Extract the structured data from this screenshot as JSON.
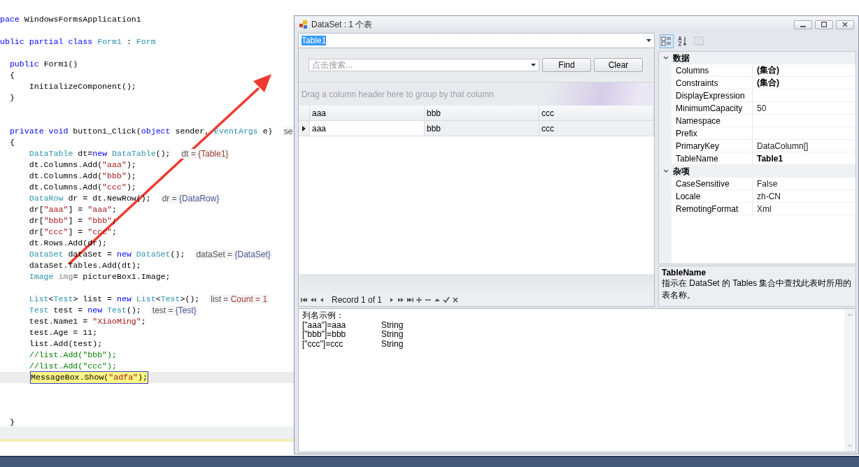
{
  "editor": {
    "lines": [
      {
        "kind": "code",
        "current": false,
        "segments": [
          {
            "kind": "keyword",
            "text": "pace"
          },
          {
            "kind": "plain",
            "text": " WindowsFormsApplication1"
          }
        ]
      },
      {
        "kind": "blank",
        "current": false
      },
      {
        "kind": "code",
        "current": false,
        "segments": [
          {
            "kind": "keyword",
            "text": "ublic partial class "
          },
          {
            "kind": "type",
            "text": "Form1"
          },
          {
            "kind": "plain",
            "text": " : "
          },
          {
            "kind": "type",
            "text": "Form"
          }
        ]
      },
      {
        "kind": "blank",
        "current": false
      },
      {
        "kind": "code",
        "current": false,
        "segments": [
          {
            "kind": "keyword",
            "text": "  public"
          },
          {
            "kind": "plain",
            "text": " Form1()"
          }
        ]
      },
      {
        "kind": "code",
        "current": false,
        "segments": [
          {
            "kind": "plain",
            "text": "  {"
          }
        ]
      },
      {
        "kind": "code",
        "current": false,
        "segments": [
          {
            "kind": "plain",
            "text": "      InitializeComponent();"
          }
        ]
      },
      {
        "kind": "code",
        "current": false,
        "segments": [
          {
            "kind": "plain",
            "text": "  }"
          }
        ]
      },
      {
        "kind": "blank",
        "current": false
      },
      {
        "kind": "blank",
        "current": false
      },
      {
        "kind": "code",
        "current": false,
        "segments": [
          {
            "kind": "keyword",
            "text": "  private void"
          },
          {
            "kind": "plain",
            "text": " button1_Click("
          },
          {
            "kind": "keyword",
            "text": "object"
          },
          {
            "kind": "plain",
            "text": " sender, "
          },
          {
            "kind": "type",
            "text": "EventArgs"
          },
          {
            "kind": "plain",
            "text": " e)"
          }
        ],
        "tip": {
          "label": "se"
        }
      },
      {
        "kind": "code",
        "current": false,
        "segments": [
          {
            "kind": "plain",
            "text": "  {"
          }
        ]
      },
      {
        "kind": "code",
        "current": false,
        "segments": [
          {
            "kind": "type",
            "text": "      DataTable"
          },
          {
            "kind": "plain",
            "text": " dt="
          },
          {
            "kind": "keyword",
            "text": "new"
          },
          {
            "kind": "type",
            "text": " DataTable"
          },
          {
            "kind": "plain",
            "text": "();"
          }
        ],
        "tip": {
          "label": "dt = ",
          "value": "{Table1}",
          "color": "#a0403a"
        }
      },
      {
        "kind": "code",
        "current": false,
        "segments": [
          {
            "kind": "plain",
            "text": "      dt.Columns.Add("
          },
          {
            "kind": "string",
            "text": "\"aaa\""
          },
          {
            "kind": "plain",
            "text": ");"
          }
        ]
      },
      {
        "kind": "code",
        "current": false,
        "segments": [
          {
            "kind": "plain",
            "text": "      dt.Columns.Add("
          },
          {
            "kind": "string",
            "text": "\"bbb\""
          },
          {
            "kind": "plain",
            "text": ");"
          }
        ]
      },
      {
        "kind": "code",
        "current": false,
        "segments": [
          {
            "kind": "plain",
            "text": "      dt.Columns.Add("
          },
          {
            "kind": "string",
            "text": "\"ccc\""
          },
          {
            "kind": "plain",
            "text": ");"
          }
        ]
      },
      {
        "kind": "code",
        "current": false,
        "segments": [
          {
            "kind": "type",
            "text": "      DataRow"
          },
          {
            "kind": "plain",
            "text": " dr = dt.NewRow();"
          }
        ],
        "tip": {
          "label": "dr = ",
          "value": "{DataRow}",
          "color": "#4a5a9a"
        }
      },
      {
        "kind": "code",
        "current": false,
        "segments": [
          {
            "kind": "plain",
            "text": "      dr["
          },
          {
            "kind": "string",
            "text": "\"aaa\""
          },
          {
            "kind": "plain",
            "text": "] = "
          },
          {
            "kind": "string",
            "text": "\"aaa\""
          },
          {
            "kind": "plain",
            "text": ";"
          }
        ]
      },
      {
        "kind": "code",
        "current": false,
        "segments": [
          {
            "kind": "plain",
            "text": "      dr["
          },
          {
            "kind": "string",
            "text": "\"bbb\""
          },
          {
            "kind": "plain",
            "text": "] = "
          },
          {
            "kind": "string",
            "text": "\"bbb\""
          },
          {
            "kind": "plain",
            "text": ";"
          }
        ]
      },
      {
        "kind": "code",
        "current": false,
        "segments": [
          {
            "kind": "plain",
            "text": "      dr["
          },
          {
            "kind": "string",
            "text": "\"ccc\""
          },
          {
            "kind": "plain",
            "text": "] = "
          },
          {
            "kind": "string",
            "text": "\"ccc\""
          },
          {
            "kind": "plain",
            "text": ";"
          }
        ]
      },
      {
        "kind": "code",
        "current": false,
        "segments": [
          {
            "kind": "plain",
            "text": "      dt.Rows.Add(dr);"
          }
        ]
      },
      {
        "kind": "code",
        "current": false,
        "segments": [
          {
            "kind": "type",
            "text": "      DataSet"
          },
          {
            "kind": "plain",
            "text": " dataSet = "
          },
          {
            "kind": "keyword",
            "text": "new"
          },
          {
            "kind": "type",
            "text": " DataSet"
          },
          {
            "kind": "plain",
            "text": "();"
          }
        ],
        "tip": {
          "label": "dataSet = ",
          "value": "{DataSet}",
          "color": "#4a5a9a"
        }
      },
      {
        "kind": "code",
        "current": false,
        "segments": [
          {
            "kind": "plain",
            "text": "      dataSet.Tables.Add(dt);"
          }
        ]
      },
      {
        "kind": "code",
        "current": false,
        "segments": [
          {
            "kind": "type",
            "text": "      Image"
          },
          {
            "kind": "faded",
            "text": " img"
          },
          {
            "kind": "plain",
            "text": "= pictureBox1.Image;"
          }
        ]
      },
      {
        "kind": "blank",
        "current": false
      },
      {
        "kind": "code",
        "current": false,
        "segments": [
          {
            "kind": "type",
            "text": "      List"
          },
          {
            "kind": "plain",
            "text": "<"
          },
          {
            "kind": "type",
            "text": "Test"
          },
          {
            "kind": "plain",
            "text": "> list = "
          },
          {
            "kind": "keyword",
            "text": "new"
          },
          {
            "kind": "type",
            "text": " List"
          },
          {
            "kind": "plain",
            "text": "<"
          },
          {
            "kind": "type",
            "text": "Test"
          },
          {
            "kind": "plain",
            "text": ">();"
          }
        ],
        "tip": {
          "label": "list = ",
          "value": "Count = 1",
          "color": "#a0403a"
        }
      },
      {
        "kind": "code",
        "current": false,
        "segments": [
          {
            "kind": "type",
            "text": "      Test"
          },
          {
            "kind": "plain",
            "text": " test = "
          },
          {
            "kind": "keyword",
            "text": "new"
          },
          {
            "kind": "type",
            "text": " Test"
          },
          {
            "kind": "plain",
            "text": "();"
          }
        ],
        "tip": {
          "label": "test = ",
          "value": "{Test}",
          "color": "#4a5a9a"
        }
      },
      {
        "kind": "code",
        "current": false,
        "segments": [
          {
            "kind": "plain",
            "text": "      test.Name1 = "
          },
          {
            "kind": "string",
            "text": "\"XiaoMing\""
          },
          {
            "kind": "plain",
            "text": ";"
          }
        ]
      },
      {
        "kind": "code",
        "current": false,
        "segments": [
          {
            "kind": "plain",
            "text": "      test.Age = 11;"
          }
        ]
      },
      {
        "kind": "code",
        "current": false,
        "segments": [
          {
            "kind": "plain",
            "text": "      list.Add(test);"
          }
        ]
      },
      {
        "kind": "code",
        "current": false,
        "segments": [
          {
            "kind": "comment",
            "text": "      //list.Add(\"bbb\");"
          }
        ]
      },
      {
        "kind": "code",
        "current": false,
        "segments": [
          {
            "kind": "comment",
            "text": "      //list.Add(\"ccc\");"
          }
        ]
      },
      {
        "kind": "code",
        "current": true,
        "segments": [
          {
            "kind": "plain",
            "text": "MessageBox.Show("
          },
          {
            "kind": "string",
            "text": "\"adfa\""
          },
          {
            "kind": "plain",
            "text": ");"
          }
        ]
      },
      {
        "kind": "blank",
        "current": false
      },
      {
        "kind": "blank",
        "current": false
      },
      {
        "kind": "blank",
        "current": false
      },
      {
        "kind": "code",
        "current": false,
        "segments": [
          {
            "kind": "plain",
            "text": "  }"
          }
        ]
      }
    ]
  },
  "window": {
    "title": "DataSet : 1 个表",
    "table_select": {
      "value": "Table1",
      "highlighted": true
    },
    "search": {
      "placeholder": "点击搜索...",
      "buttons": [
        "Find",
        "Clear"
      ]
    },
    "group_panel": "Drag a column header here to group by that column",
    "grid": {
      "columns": [
        "aaa",
        "bbb",
        "ccc"
      ],
      "rows": [
        {
          "cells": [
            "aaa",
            "bbb",
            "ccc"
          ],
          "current": true
        }
      ]
    },
    "navigator": {
      "record": "Record 1 of 1"
    },
    "toolbar": [
      {
        "kind": "categorized",
        "selected": true,
        "disabled": false
      },
      {
        "kind": "alphabetical",
        "selected": false,
        "disabled": false
      },
      {
        "kind": "pages",
        "selected": false,
        "disabled": true
      }
    ],
    "property_grid": {
      "categories": [
        {
          "name": "数据",
          "expanded": true,
          "properties": [
            {
              "name": "Columns",
              "value": "(集合)",
              "bold": true
            },
            {
              "name": "Constraints",
              "value": "(集合)",
              "bold": true
            },
            {
              "name": "DisplayExpression"
            },
            {
              "name": "MinimumCapacity",
              "value": "50",
              "bold": false
            },
            {
              "name": "Namespace"
            },
            {
              "name": "Prefix"
            },
            {
              "name": "PrimaryKey",
              "value": "DataColumn[]",
              "bold": false
            },
            {
              "name": "TableName",
              "value": "Table1",
              "bold": true
            }
          ]
        },
        {
          "name": "杂项",
          "expanded": true,
          "properties": [
            {
              "name": "CaseSensitive",
              "value": "False",
              "bold": false
            },
            {
              "name": "Locale",
              "value": "zh-CN",
              "bold": false
            },
            {
              "name": "RemotingFormat",
              "value": "Xml",
              "bold": false
            }
          ]
        }
      ]
    },
    "description": {
      "title": "TableName",
      "text": "指示在 DataSet 的 Tables 集合中查找此表时所用的表名称。"
    },
    "output": {
      "heading": "列名示例：",
      "rows": [
        {
          "expr": "[\"aaa\"]=aaa",
          "type": "String"
        },
        {
          "expr": "[\"bbb\"]=bbb",
          "type": "String"
        },
        {
          "expr": "[\"ccc\"]=ccc",
          "type": "String"
        }
      ]
    }
  }
}
